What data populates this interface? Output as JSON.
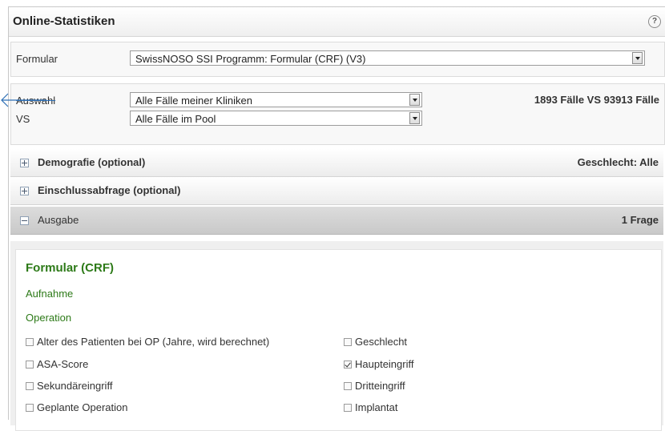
{
  "header": {
    "title": "Online-Statistiken",
    "help": "?"
  },
  "form": {
    "label": "Formular",
    "selected": "SwissNOSO SSI Programm: Formular (CRF) (V3)"
  },
  "selection": {
    "auswahl_label": "Auswahl",
    "auswahl_value": "Alle Fälle meiner Kliniken",
    "vs_label": "VS",
    "vs_value": "Alle Fälle im Pool",
    "count": "1893 Fälle VS 93913 Fälle"
  },
  "sections": [
    {
      "title": "Demografie (optional)",
      "right": "Geschlecht: Alle",
      "expanded": false
    },
    {
      "title": "Einschlussabfrage (optional)",
      "right": "",
      "expanded": false
    },
    {
      "title": "Ausgabe",
      "right": "1 Frage",
      "expanded": true
    }
  ],
  "output": {
    "heading": "Formular (CRF)",
    "groups": [
      "Aufnahme",
      "Operation"
    ],
    "checkboxes": [
      {
        "label": "Alter des Patienten bei OP (Jahre, wird berechnet)",
        "checked": false
      },
      {
        "label": "Geschlecht",
        "checked": false
      },
      {
        "label": "ASA-Score",
        "checked": false
      },
      {
        "label": "Haupteingriff",
        "checked": true
      },
      {
        "label": "Sekundäreingriff",
        "checked": false
      },
      {
        "label": "Dritteingriff",
        "checked": false
      },
      {
        "label": "Geplante Operation",
        "checked": false
      },
      {
        "label": "Implantat",
        "checked": false
      }
    ]
  },
  "colors": {
    "accent_green": "#2d7a18",
    "arrow_blue": "#2e6fb5"
  }
}
